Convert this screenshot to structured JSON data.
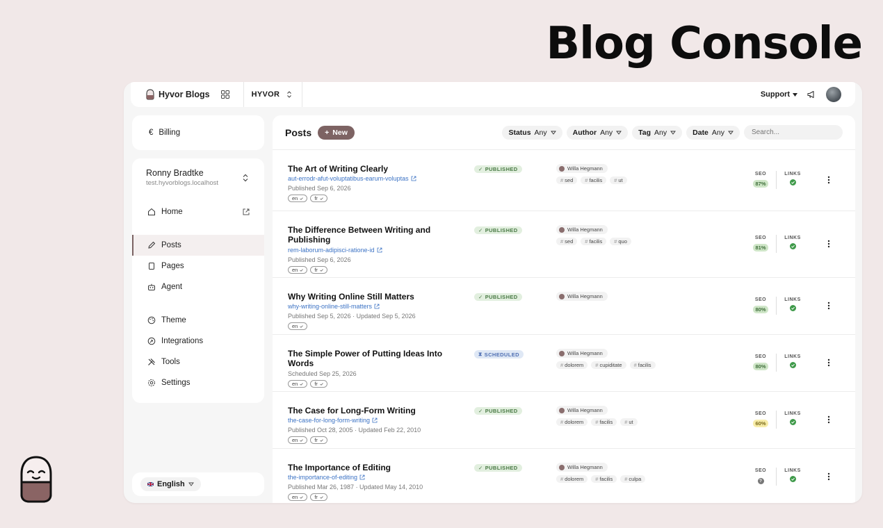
{
  "hero_title": "Blog Console",
  "colors": {
    "accent": "#7d6363",
    "background": "#f1e8e8",
    "link": "#3b72c4",
    "published_bg": "#e2efdf",
    "scheduled_bg": "#dfe8f5",
    "seo_green": "#cfe6c8",
    "seo_yellow": "#f7eca8"
  },
  "topbar": {
    "brand": "Hyvor Blogs",
    "blog": "HYVOR",
    "support": "Support"
  },
  "sidebar": {
    "billing": "Billing",
    "billing_symbol": "€",
    "user_name": "Ronny Bradtke",
    "user_site": "test.hyvorblogs.localhost",
    "items": [
      {
        "label": "Home",
        "icon": "home-icon"
      },
      {
        "label": "Posts",
        "icon": "pencil-icon",
        "active": true
      },
      {
        "label": "Pages",
        "icon": "page-icon"
      },
      {
        "label": "Agent",
        "icon": "robot-icon"
      },
      {
        "label": "Theme",
        "icon": "palette-icon"
      },
      {
        "label": "Integrations",
        "icon": "plug-icon"
      },
      {
        "label": "Tools",
        "icon": "tools-icon"
      },
      {
        "label": "Settings",
        "icon": "gear-icon"
      }
    ],
    "language": "English"
  },
  "main": {
    "title": "Posts",
    "new_label": "New",
    "filters": [
      {
        "label": "Status",
        "value": "Any"
      },
      {
        "label": "Author",
        "value": "Any"
      },
      {
        "label": "Tag",
        "value": "Any"
      },
      {
        "label": "Date",
        "value": "Any"
      }
    ],
    "search_placeholder": "Search...",
    "seo_label": "SEO",
    "links_label": "LINKS",
    "posts": [
      {
        "title": "The Art of Writing Clearly",
        "slug": "aut-errodr-afut-voluptatibus-earum-voluptas",
        "meta": "Published Sep 6, 2026",
        "langs": [
          "en",
          "fr"
        ],
        "status": "PUBLISHED",
        "author": "Willa Hegmann",
        "tags": [
          "sed",
          "facilis",
          "ut"
        ],
        "seo": "87%",
        "seo_level": "green"
      },
      {
        "title": "The Difference Between Writing and Publishing",
        "slug": "rem-laborum-adipisci-ratione-id",
        "meta": "Published Sep 6, 2026",
        "langs": [
          "en",
          "fr"
        ],
        "status": "PUBLISHED",
        "author": "Willa Hegmann",
        "tags": [
          "sed",
          "facilis",
          "quo"
        ],
        "seo": "81%",
        "seo_level": "green"
      },
      {
        "title": "Why Writing Online Still Matters",
        "slug": "why-writing-online-still-matters",
        "meta": "Published Sep 5, 2026 · Updated Sep 5, 2026",
        "langs": [
          "en"
        ],
        "status": "PUBLISHED",
        "author": "Willa Hegmann",
        "tags": [],
        "seo": "80%",
        "seo_level": "green"
      },
      {
        "title": "The Simple Power of Putting Ideas Into Words",
        "slug": "",
        "meta": "Scheduled Sep 25, 2026",
        "langs": [
          "en",
          "fr"
        ],
        "status": "SCHEDULED",
        "author": "Willa Hegmann",
        "tags": [
          "dolorem",
          "cupiditate",
          "facilis"
        ],
        "seo": "80%",
        "seo_level": "green"
      },
      {
        "title": "The Case for Long-Form Writing",
        "slug": "the-case-for-long-form-writing",
        "meta": "Published Oct 28, 2005 · Updated Feb 22, 2010",
        "langs": [
          "en",
          "fr"
        ],
        "status": "PUBLISHED",
        "author": "Willa Hegmann",
        "tags": [
          "dolorem",
          "facilis",
          "ut"
        ],
        "seo": "60%",
        "seo_level": "yellow"
      },
      {
        "title": "The Importance of Editing",
        "slug": "the-importance-of-editing",
        "meta": "Published Mar 26, 1987 · Updated May 14, 2010",
        "langs": [
          "en",
          "fr"
        ],
        "status": "PUBLISHED",
        "author": "Willa Hegmann",
        "tags": [
          "dolorem",
          "facilis",
          "culpa"
        ],
        "seo": "?",
        "seo_level": "gray"
      }
    ]
  }
}
